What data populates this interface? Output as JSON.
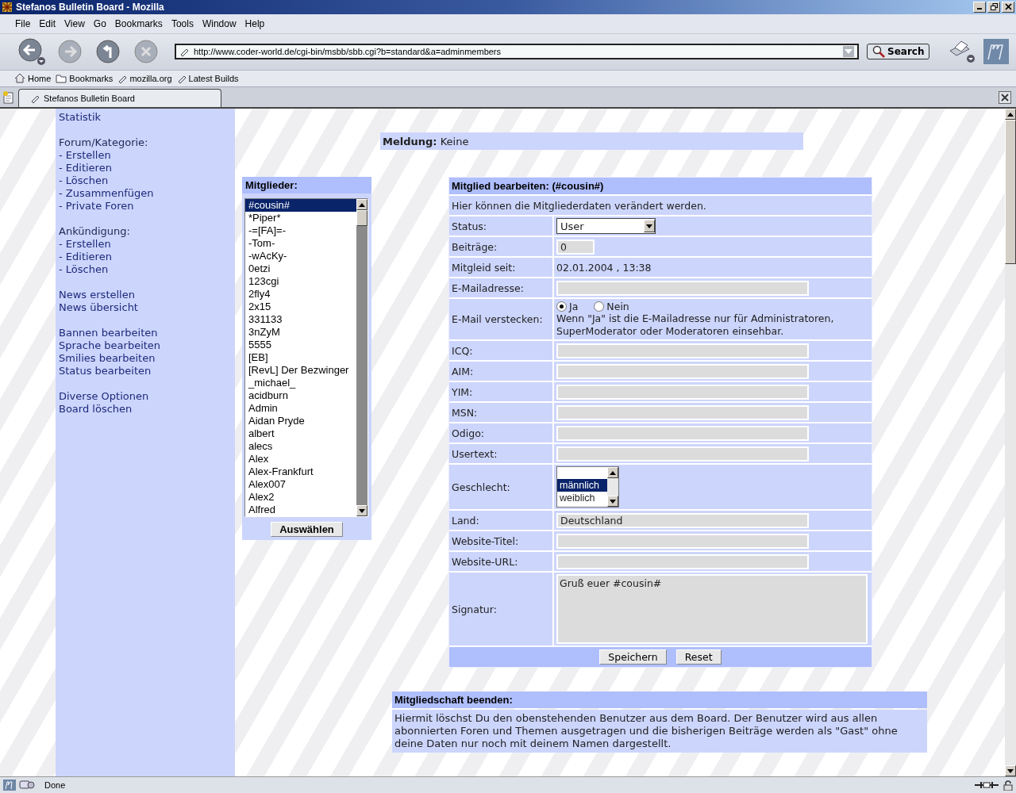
{
  "window": {
    "title": "Stefanos Bulletin Board - Mozilla"
  },
  "menu": [
    "File",
    "Edit",
    "View",
    "Go",
    "Bookmarks",
    "Tools",
    "Window",
    "Help"
  ],
  "url": "http://www.coder-world.de/cgi-bin/msbb/sbb.cgi?b=standard&a=adminmembers",
  "search_button": "Search",
  "bookmarks": [
    {
      "kind": "home",
      "label": "Home"
    },
    {
      "kind": "folder",
      "label": "Bookmarks"
    },
    {
      "kind": "link",
      "label": "mozilla.org"
    },
    {
      "kind": "link",
      "label": "Latest Builds"
    }
  ],
  "tabs": [
    {
      "label": "Stefanos Bulletin Board",
      "selected": true
    }
  ],
  "sidebar": {
    "groups": [
      [
        {
          "kind": "link",
          "label": "Statistik"
        }
      ],
      [
        {
          "kind": "heading",
          "label": "Forum/Kategorie:"
        },
        {
          "kind": "link",
          "label": "- Erstellen"
        },
        {
          "kind": "link",
          "label": "- Editieren"
        },
        {
          "kind": "link",
          "label": "- Löschen"
        },
        {
          "kind": "link",
          "label": "- Zusammenfügen"
        },
        {
          "kind": "link",
          "label": "- Private Foren"
        }
      ],
      [
        {
          "kind": "heading",
          "label": "Ankündigung:"
        },
        {
          "kind": "link",
          "label": "- Erstellen"
        },
        {
          "kind": "link",
          "label": "- Editieren"
        },
        {
          "kind": "link",
          "label": "- Löschen"
        }
      ],
      [
        {
          "kind": "link",
          "label": "News erstellen"
        },
        {
          "kind": "link",
          "label": "News übersicht"
        }
      ],
      [
        {
          "kind": "link",
          "label": "Bannen bearbeiten"
        },
        {
          "kind": "link",
          "label": "Sprache bearbeiten"
        },
        {
          "kind": "link",
          "label": "Smilies bearbeiten"
        },
        {
          "kind": "link",
          "label": "Status bearbeiten"
        }
      ],
      [
        {
          "kind": "link",
          "label": "Diverse Optionen"
        },
        {
          "kind": "link",
          "label": "Board löschen"
        }
      ]
    ]
  },
  "message": {
    "label": "Meldung:",
    "value": "Keine"
  },
  "members": {
    "title": "Mitglieder:",
    "items": [
      {
        "label": "#cousin#",
        "selected": true
      },
      {
        "label": "*Piper*",
        "selected": false
      },
      {
        "label": "-=[FA]=-",
        "selected": false
      },
      {
        "label": "-Tom-",
        "selected": false
      },
      {
        "label": "-wAcKy-",
        "selected": false
      },
      {
        "label": "0etzi",
        "selected": false
      },
      {
        "label": "123cgi",
        "selected": false
      },
      {
        "label": "2fly4",
        "selected": false
      },
      {
        "label": "2x15",
        "selected": false
      },
      {
        "label": "331133",
        "selected": false
      },
      {
        "label": "3nZyM",
        "selected": false
      },
      {
        "label": "5555",
        "selected": false
      },
      {
        "label": "[EB]",
        "selected": false
      },
      {
        "label": "[RevL] Der Bezwinger",
        "selected": false
      },
      {
        "label": "_michael_",
        "selected": false
      },
      {
        "label": "acidburn",
        "selected": false
      },
      {
        "label": "Admin",
        "selected": false
      },
      {
        "label": "Aidan Pryde",
        "selected": false
      },
      {
        "label": "albert",
        "selected": false
      },
      {
        "label": "alecs",
        "selected": false
      },
      {
        "label": "Alex",
        "selected": false
      },
      {
        "label": "Alex-Frankfurt",
        "selected": false
      },
      {
        "label": "Alex007",
        "selected": false
      },
      {
        "label": "Alex2",
        "selected": false
      },
      {
        "label": "Alfred",
        "selected": false
      }
    ],
    "button": "Auswählen"
  },
  "edit_form": {
    "title": "Mitglied bearbeiten: (#cousin#)",
    "intro": "Hier können die Mitgliederdaten verändert werden.",
    "rows": [
      {
        "kind": "select",
        "label": "Status:",
        "value": "User"
      },
      {
        "kind": "short_input",
        "label": "Beiträge:",
        "value": "0"
      },
      {
        "kind": "text",
        "label": "Mitgleid seit:",
        "value": "02.01.2004 , 13:38"
      },
      {
        "kind": "input",
        "label": "E-Mailadresse:"
      },
      {
        "kind": "radio",
        "label": "E-Mail verstecken:",
        "options": [
          {
            "label": "Ja",
            "selected": true
          },
          {
            "label": "Nein",
            "selected": false
          }
        ],
        "note": "Wenn \"Ja\" ist die E-Mailadresse nur für Administratoren, SuperModerator oder Moderatoren einsehbar."
      },
      {
        "kind": "input",
        "label": "ICQ:"
      },
      {
        "kind": "input",
        "label": "AIM:"
      },
      {
        "kind": "input",
        "label": "YIM:"
      },
      {
        "kind": "input",
        "label": "MSN:"
      },
      {
        "kind": "input",
        "label": "Odigo:"
      },
      {
        "kind": "input",
        "label": "Usertext:"
      },
      {
        "kind": "listbox",
        "label": "Geschlecht:",
        "options": [
          {
            "label": "männlich",
            "selected": true
          },
          {
            "label": "weiblich",
            "selected": false
          }
        ]
      },
      {
        "kind": "input",
        "label": "Land:",
        "value": "Deutschland"
      },
      {
        "kind": "input",
        "label": "Website-Titel:"
      },
      {
        "kind": "input",
        "label": "Website-URL:"
      },
      {
        "kind": "textarea",
        "label": "Signatur:",
        "value": "Gruß euer #cousin#"
      }
    ],
    "buttons": [
      "Speichern",
      "Reset"
    ]
  },
  "end_membership": {
    "title": "Mitgliedschaft beenden:",
    "text": "Hiermit löschst Du den obenstehenden Benutzer aus dem Board. Der Benutzer wird aus allen abonnierten Foren und Themen ausgetragen und die bisherigen Beiträge werden als \"Gast\" ohne deine Daten nur noch mit deinem Namen dargestellt."
  },
  "status_bar": {
    "text": "Done"
  }
}
